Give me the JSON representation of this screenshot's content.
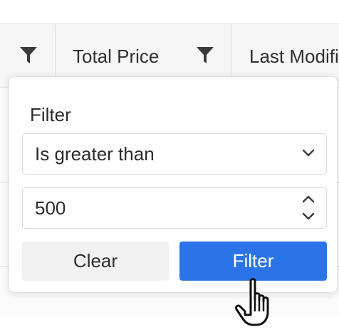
{
  "grid": {
    "columns": [
      {
        "label": "",
        "has_filter": true
      },
      {
        "label": "Total Price",
        "has_filter": true
      },
      {
        "label": "Last Modifi",
        "has_filter": false
      }
    ]
  },
  "filter_popup": {
    "title": "Filter",
    "operator": {
      "selected": "Is greater than",
      "icon": "chevron-down-icon"
    },
    "value_input": {
      "value": "500",
      "icons": [
        "chevron-up-icon",
        "chevron-down-icon"
      ]
    },
    "buttons": {
      "clear_label": "Clear",
      "filter_label": "Filter"
    },
    "colors": {
      "primary": "#2b74e8",
      "secondary": "#f1f1f1"
    }
  },
  "cursor": {
    "type": "hand-pointer-icon"
  }
}
